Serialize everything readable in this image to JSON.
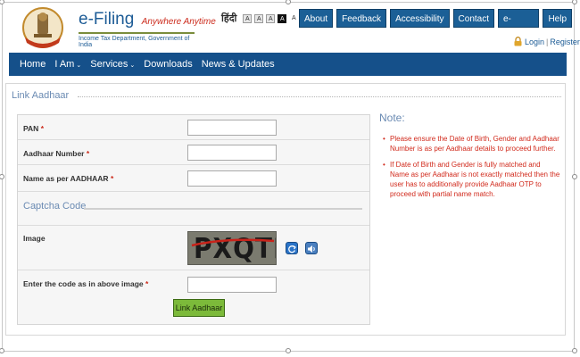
{
  "header": {
    "brand_title": "e-Filing",
    "brand_tagline": "Anywhere Anytime",
    "brand_sub": "Income Tax Department, Government of India",
    "lang_hindi": "हिंदी",
    "font_size_labels": [
      "A",
      "A",
      "A",
      "A",
      "A"
    ],
    "top_nav": [
      "About Us",
      "Feedback",
      "Accessibility Options",
      "Contact Us",
      "e-Nivaran",
      "Help"
    ],
    "login_label": "Login",
    "separator": "|",
    "register_label": "Register"
  },
  "main_nav": [
    {
      "label": "Home",
      "has_menu": false
    },
    {
      "label": "I Am",
      "has_menu": true
    },
    {
      "label": "Services",
      "has_menu": true
    },
    {
      "label": "Downloads",
      "has_menu": false
    },
    {
      "label": "News & Updates",
      "has_menu": false
    }
  ],
  "panel": {
    "title": "Link Aadhaar",
    "form": {
      "pan_label": "PAN",
      "aadhaar_label": "Aadhaar Number",
      "name_label": "Name as per AADHAAR",
      "required_mark": "*",
      "captcha_heading": "Captcha Code",
      "image_label": "Image",
      "captcha_text": "PXQTFT",
      "code_label": "Enter the code as in above image",
      "pan_value": "",
      "aadhaar_value": "",
      "name_value": "",
      "code_value": "",
      "submit_label": "Link Aadhaar"
    },
    "note": {
      "title": "Note:",
      "items": [
        "Please ensure the Date of Birth, Gender and Aadhaar Number is as per Aadhaar details to proceed further.",
        "If Date of Birth and Gender is fully matched and Name as per Aadhaar is not exactly matched then the user has to additionally provide Aadhaar OTP to proceed with partial name match."
      ]
    }
  },
  "colors": {
    "brand_blue": "#15508a",
    "accent_red": "#d12a1c",
    "button_green": "#7cba3a"
  }
}
